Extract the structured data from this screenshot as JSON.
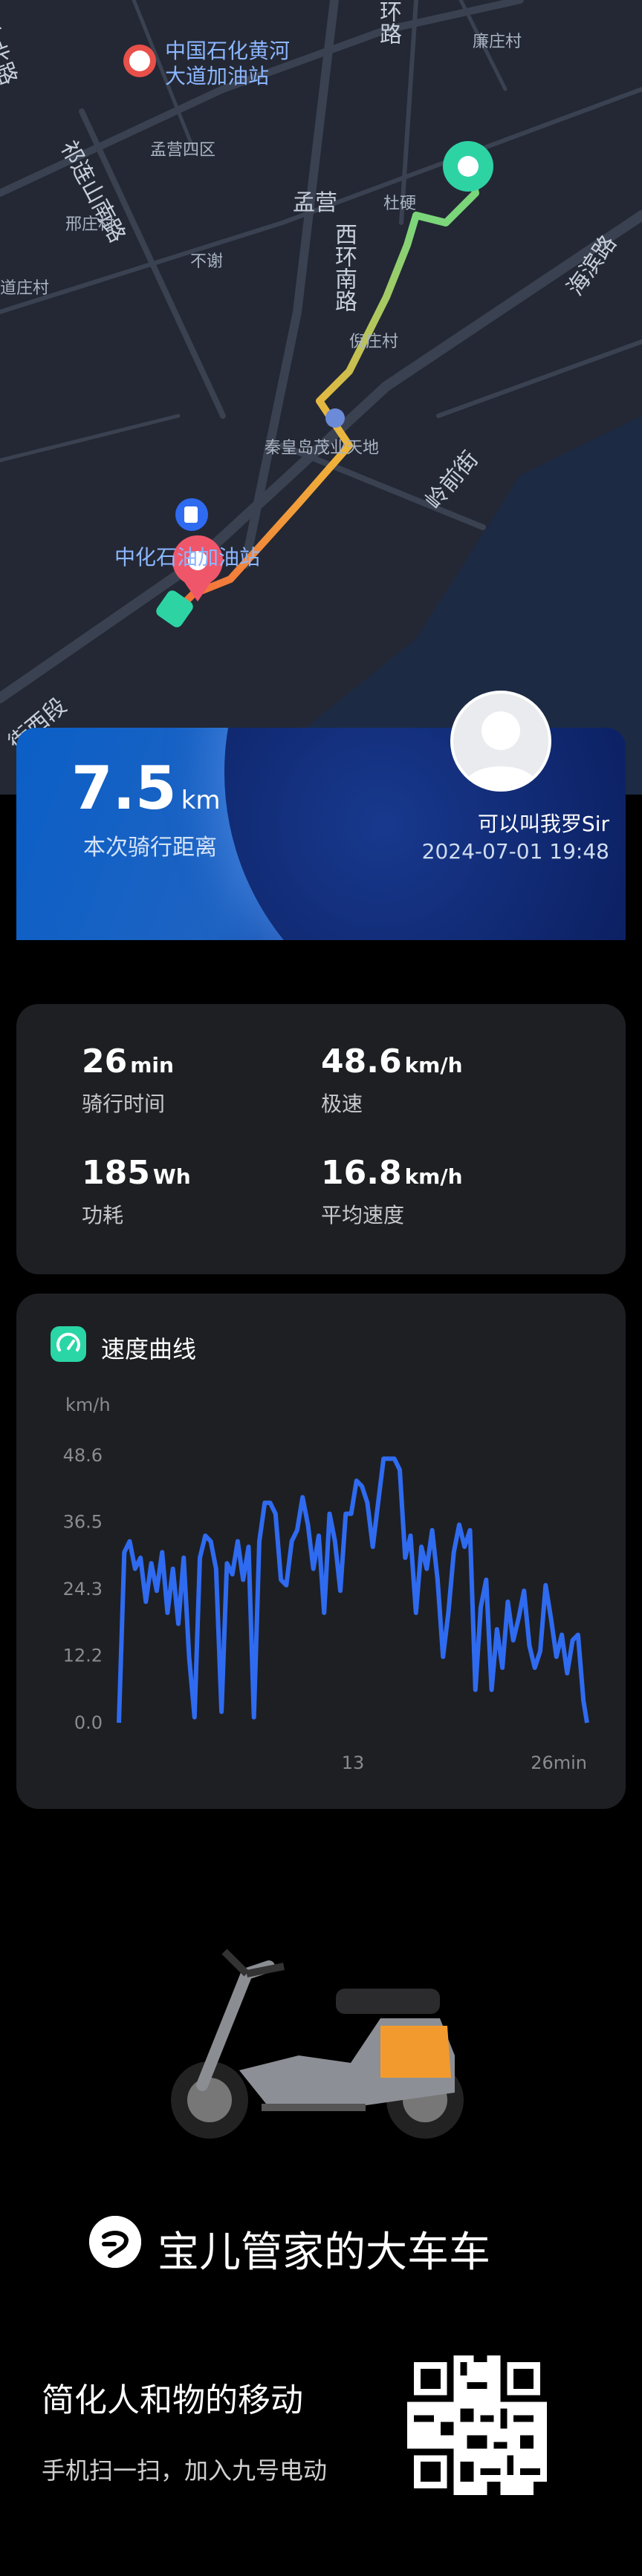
{
  "map": {
    "labels": {
      "gas_station_1": "中国石化黄河\n大道加油站",
      "road_north": "山北路",
      "road_huan": "环路",
      "lianzhuang": "廉庄村",
      "qilian_road": "祁连山南路",
      "mengying_4": "孟营四区",
      "mengying": "孟营",
      "xingzhuang": "邢庄村",
      "buxie": "不谢",
      "daozhuang": "道庄村",
      "xihuan_road": "西环南路",
      "zhangzhuang": "杜硬",
      "ni_zhuang": "倪庄村",
      "coastal": "海滨路",
      "mall": "秦皇岛茂业天地",
      "lingqian": "岭前街",
      "gas_station_2": "中化石油加油站",
      "xi_duan": "街西段"
    }
  },
  "ride": {
    "distance_value": "7.5",
    "distance_unit": "km",
    "distance_label": "本次骑行距离",
    "user_name": "可以叫我罗Sir",
    "datetime": "2024-07-01 19:48"
  },
  "stats": [
    {
      "value": "26",
      "unit": "min",
      "label": "骑行时间"
    },
    {
      "value": "48.6",
      "unit": "km/h",
      "label": "极速"
    },
    {
      "value": "185",
      "unit": "Wh",
      "label": "功耗"
    },
    {
      "value": "16.8",
      "unit": "km/h",
      "label": "平均速度"
    }
  ],
  "speed_chart": {
    "title": "速度曲线",
    "icon": "speedometer-icon",
    "chart_data": {
      "type": "line",
      "ylabel": "km/h",
      "xlabel": "",
      "ylim": [
        0,
        48.6
      ],
      "yticks": [
        0.0,
        12.2,
        24.3,
        36.5,
        48.6
      ],
      "ytick_labels": [
        "0.0",
        "12.2",
        "24.3",
        "36.5",
        "48.6"
      ],
      "xlim": [
        0,
        26
      ],
      "xtick_labels": [
        {
          "x": 13,
          "label": "13"
        },
        {
          "x": 26,
          "label": "26min"
        }
      ],
      "line_color": "#2f6bf0",
      "series": [
        {
          "x": [
            0,
            0.3,
            0.6,
            0.9,
            1.2,
            1.5,
            1.8,
            2.1,
            2.4,
            2.7,
            3.0,
            3.3,
            3.6,
            3.9,
            4.2,
            4.5,
            4.8,
            5.1,
            5.4,
            5.7,
            6.0,
            6.3,
            6.6,
            6.9,
            7.2,
            7.5,
            7.8,
            8.1,
            8.4,
            8.7,
            9.0,
            9.3,
            9.6,
            9.9,
            10.2,
            10.5,
            10.8,
            11.1,
            11.4,
            11.7,
            12.0,
            12.3,
            12.6,
            12.9,
            13.2,
            13.5,
            13.8,
            14.1,
            14.4,
            14.7,
            15.0,
            15.3,
            15.6,
            15.9,
            16.2,
            16.5,
            16.8,
            17.1,
            17.4,
            17.7,
            18.0,
            18.3,
            18.6,
            18.9,
            19.2,
            19.5,
            19.8,
            20.1,
            20.4,
            20.7,
            21.0,
            21.3,
            21.6,
            21.9,
            22.2,
            22.5,
            22.8,
            23.1,
            23.4,
            23.7,
            24.0,
            24.3,
            24.6,
            24.9,
            25.2,
            25.5,
            25.8,
            26.0
          ],
          "values": [
            0,
            31,
            33,
            28,
            30,
            22,
            29,
            24,
            31,
            20,
            28,
            18,
            30,
            12,
            1,
            30,
            34,
            33,
            28,
            2,
            29,
            27,
            33,
            26,
            32,
            1,
            33,
            40,
            40,
            38,
            26,
            25,
            33,
            35,
            41,
            36,
            28,
            34,
            20,
            38,
            33,
            24,
            38,
            38,
            44,
            43,
            40,
            32,
            40,
            48,
            48,
            48,
            46,
            30,
            34,
            20,
            32,
            28,
            35,
            26,
            12,
            20,
            31,
            36,
            32,
            35,
            6,
            21,
            26,
            6,
            17,
            10,
            22,
            15,
            19,
            24,
            14,
            10,
            13,
            25,
            19,
            12,
            16,
            9,
            15,
            16,
            4,
            0
          ]
        }
      ]
    }
  },
  "brand": {
    "name": "宝儿管家的大车车",
    "slogan": "简化人和物的移动",
    "scan_text": "手机扫一扫，加入九号电动"
  }
}
